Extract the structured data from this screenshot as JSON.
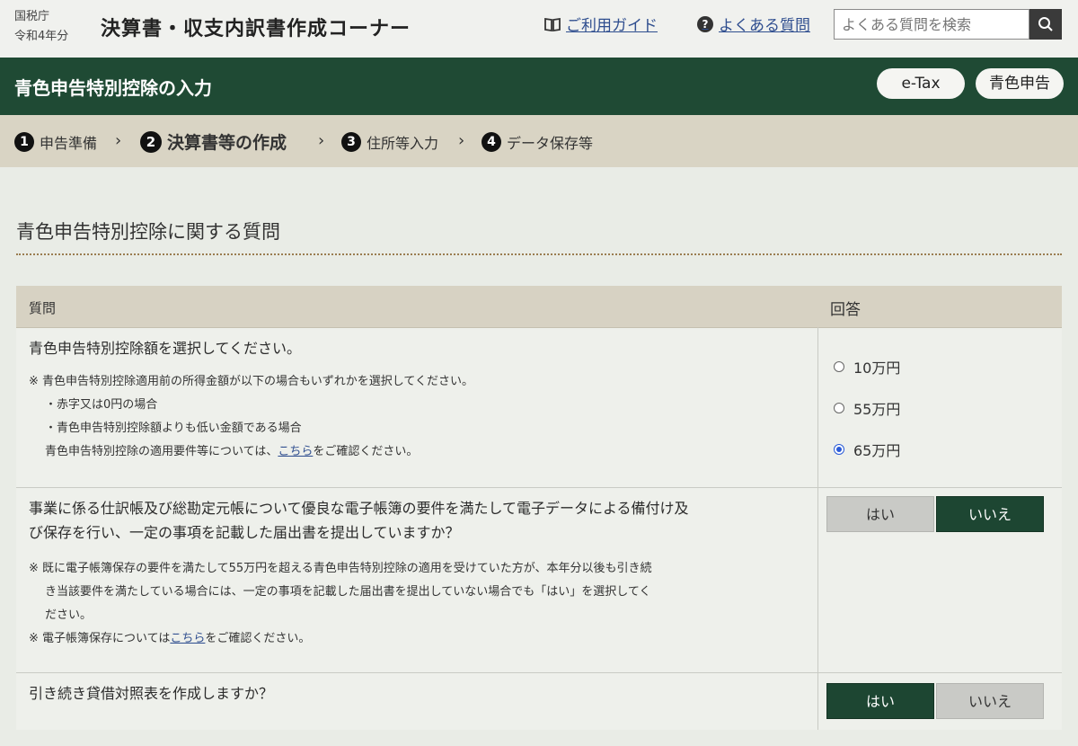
{
  "header": {
    "agency": "国税庁",
    "year": "令和4年分",
    "app_title": "決算書・収支内訳書作成コーナー",
    "guide_label": "ご利用ガイド",
    "faq_label": "よくある質問",
    "search_placeholder": "よくある質問を検索"
  },
  "page": {
    "title": "青色申告特別控除の入力",
    "etax_label": "e-Tax",
    "blue_label": "青色申告"
  },
  "steps": [
    {
      "num": "1",
      "label": "申告準備"
    },
    {
      "num": "2",
      "label": "決算書等の作成"
    },
    {
      "num": "3",
      "label": "住所等入力"
    },
    {
      "num": "4",
      "label": "データ保存等"
    }
  ],
  "section": {
    "title": "青色申告特別控除に関する質問"
  },
  "table": {
    "col_question": "質問",
    "col_answer": "回答",
    "rows": [
      {
        "question": "青色申告特別控除額を選択してください。",
        "note1": "※ 青色申告特別控除適用前の所得金額が以下の場合もいずれかを選択してください。",
        "note2": "・赤字又は0円の場合",
        "note3": "・青色申告特別控除額よりも低い金額である場合",
        "note4_pre": "青色申告特別控除の適用要件等については、",
        "note4_link": "こちら",
        "note4_post": "をご確認ください。",
        "options": [
          "10万円",
          "55万円",
          "65万円"
        ],
        "selected": "65万円"
      },
      {
        "question_line1": "事業に係る仕訳帳及び総勘定元帳について優良な電子帳簿の要件を満たして電子データによる備付け及",
        "question_line2": "び保存を行い、一定の事項を記載した届出書を提出していますか？",
        "note1": "※ 既に電子帳簿保存の要件を満たして55万円を超える青色申告特別控除の適用を受けていた方が、本年分以後も引き続",
        "note2": "き当該要件を満たしている場合には、一定の事項を記載した届出書を提出していない場合でも「はい」を選択してく",
        "note3": "ださい。",
        "note4_pre": "※ 電子帳簿保存については",
        "note4_link": "こちら",
        "note4_post": "をご確認ください。",
        "yes_label": "はい",
        "no_label": "いいえ",
        "selected": "いいえ"
      },
      {
        "question": "引き続き貸借対照表を作成しますか？",
        "yes_label": "はい",
        "no_label": "いいえ",
        "selected": "はい"
      }
    ]
  },
  "colors": {
    "green": "#1f4a34",
    "beige": "#d9d4c4",
    "link": "#2f4e8f",
    "radio": "#2a5bd7"
  }
}
